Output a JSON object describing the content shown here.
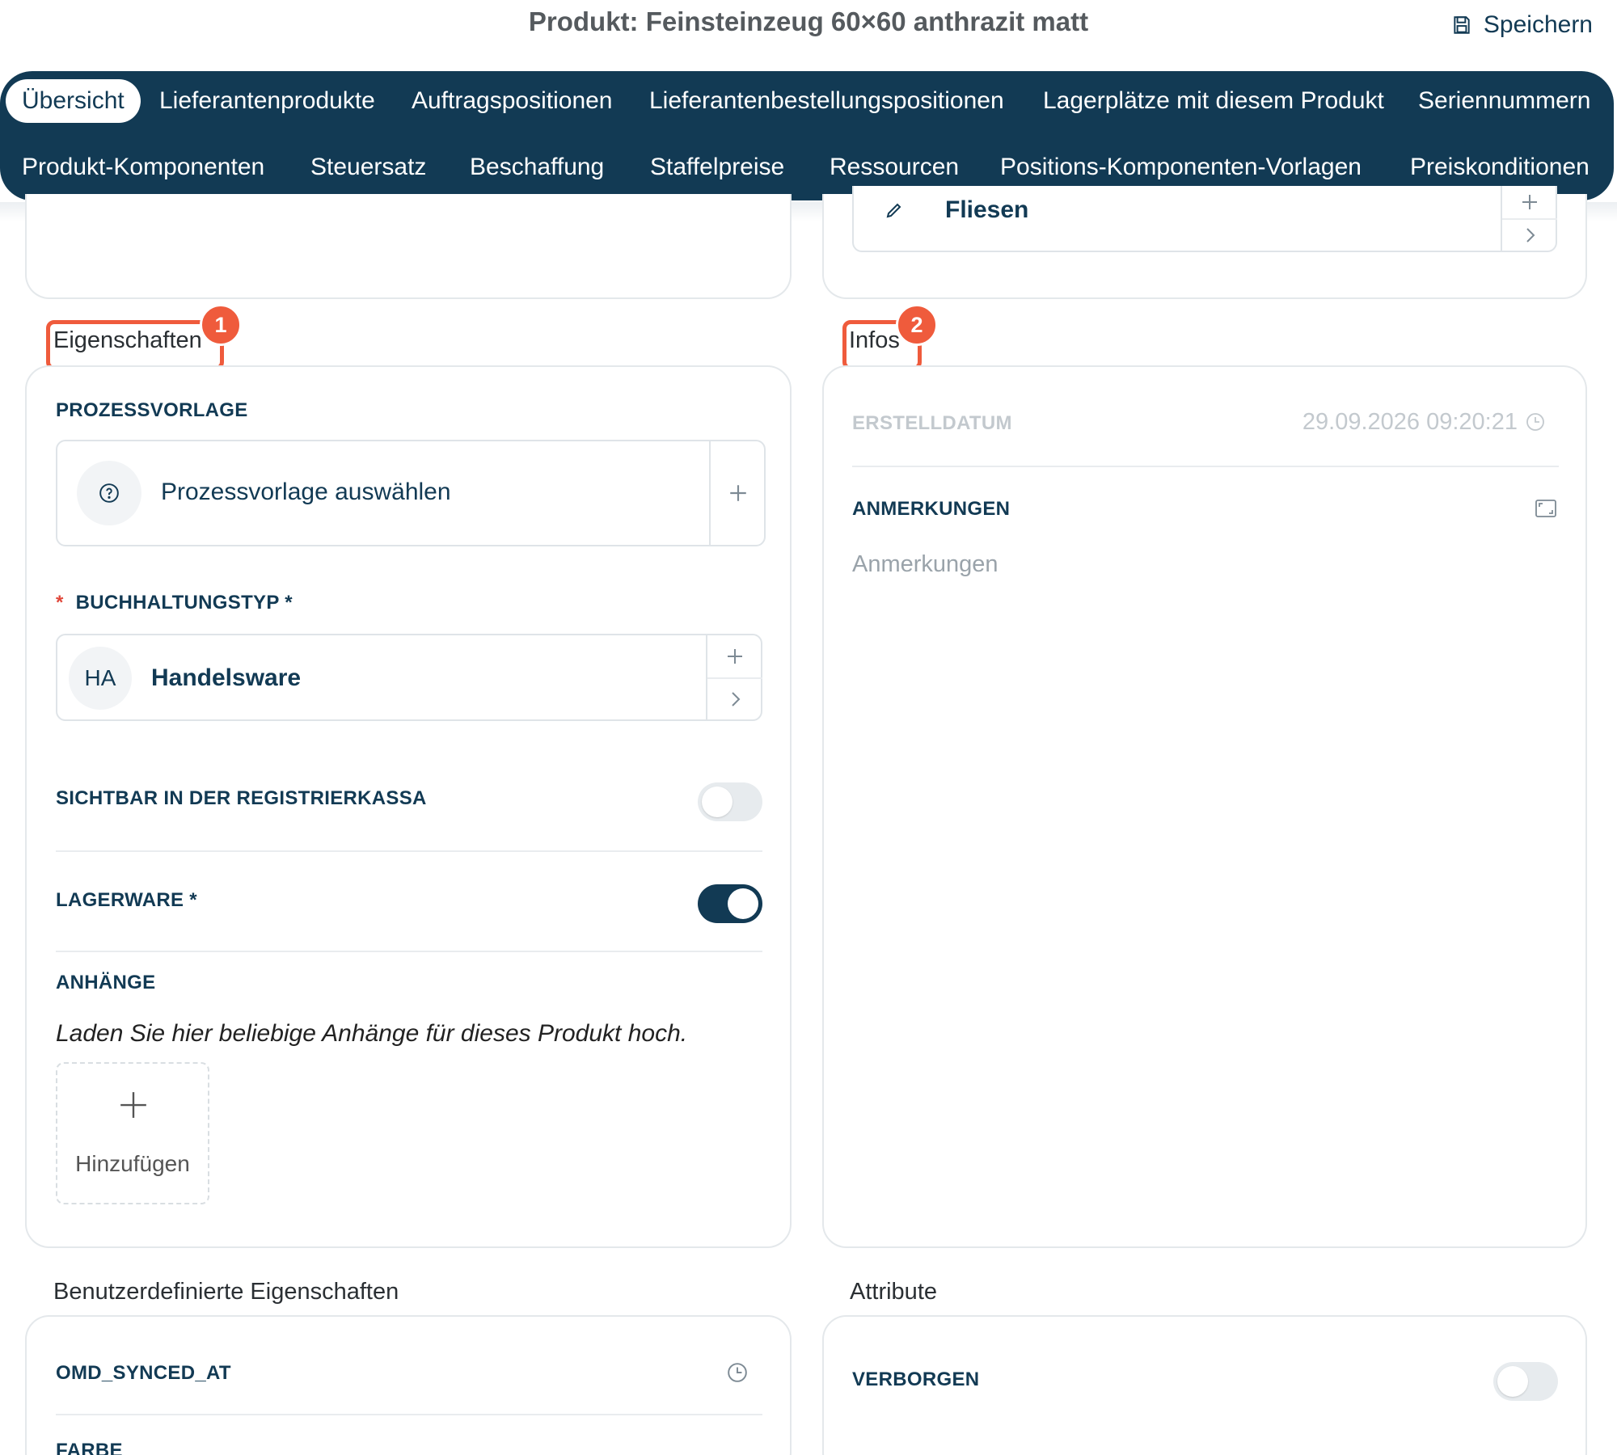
{
  "header": {
    "title": "Produkt: Feinsteinzeug 60×60 anthrazit matt",
    "save_label": "Speichern"
  },
  "tabs_row1": [
    {
      "label": "Übersicht",
      "active": true
    },
    {
      "label": "Lieferantenprodukte"
    },
    {
      "label": "Auftragspositionen"
    },
    {
      "label": "Lieferantenbestellungspositionen"
    },
    {
      "label": "Lagerplätze mit diesem Produkt"
    },
    {
      "label": "Seriennummern"
    }
  ],
  "tabs_row2": [
    {
      "label": "Produkt-Komponenten"
    },
    {
      "label": "Steuersatz"
    },
    {
      "label": "Beschaffung"
    },
    {
      "label": "Staffelpreise"
    },
    {
      "label": "Ressourcen"
    },
    {
      "label": "Positions-Komponenten-Vorlagen"
    },
    {
      "label": "Preiskonditionen"
    }
  ],
  "top_right_card": {
    "category_value": "Fliesen"
  },
  "eigenschaften": {
    "title": "Eigenschaften",
    "badge": "1",
    "prozessvorlage": {
      "label": "PROZESSVORLAGE",
      "placeholder": "Prozessvorlage auswählen"
    },
    "buchhaltungstyp": {
      "label": "BUCHHALTUNGSTYP *",
      "required_marker": "*",
      "avatar": "HA",
      "value": "Handelsware"
    },
    "sichtbar": {
      "label": "SICHTBAR IN DER REGISTRIERKASSA",
      "on": false
    },
    "lagerware": {
      "label": "LAGERWARE *",
      "on": true
    },
    "anhaenge": {
      "label": "ANHÄNGE",
      "hint": "Laden Sie hier beliebige Anhänge für dieses Produkt hoch.",
      "add_label": "Hinzufügen"
    }
  },
  "infos": {
    "title": "Infos",
    "badge": "2",
    "erstelldatum": {
      "label": "ERSTELLDATUM",
      "value": "29.09.2026 09:20:21"
    },
    "anmerkungen": {
      "label": "ANMERKUNGEN",
      "placeholder": "Anmerkungen"
    }
  },
  "benutzerdefiniert": {
    "title": "Benutzerdefinierte Eigenschaften",
    "fields": [
      "OMD_SYNCED_AT",
      "FARBE"
    ]
  },
  "attribute": {
    "title": "Attribute",
    "verborgen": {
      "label": "VERBORGEN",
      "on": false
    }
  },
  "colors": {
    "primary": "#123a54",
    "highlight": "#ef5b3c",
    "border": "#e4e8eb"
  }
}
